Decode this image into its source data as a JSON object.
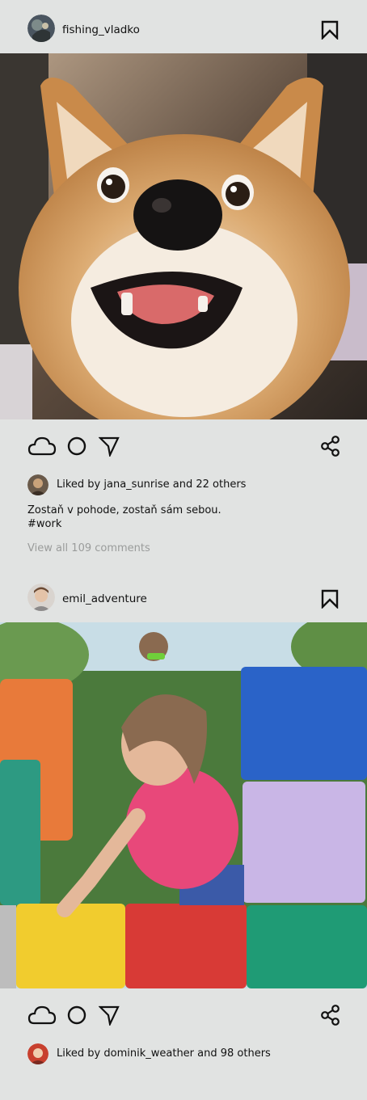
{
  "posts": [
    {
      "username": "fishing_vladko",
      "likes_prefix": "Liked by ",
      "likes_user": "jana_sunrise",
      "likes_suffix": " and 22 others",
      "caption": "Zostaň v pohode, zostaň sám sebou.",
      "hashtag": "#work",
      "comments_link": "View all 109 comments"
    },
    {
      "username": "emil_adventure",
      "likes_prefix": "Liked by ",
      "likes_user": "dominik_weather",
      "likes_suffix": " and 98 others"
    }
  ],
  "icons": {
    "bookmark": "bookmark-icon",
    "like": "cloud-icon",
    "comment": "circle-icon",
    "send": "send-icon",
    "share": "share-icon"
  }
}
